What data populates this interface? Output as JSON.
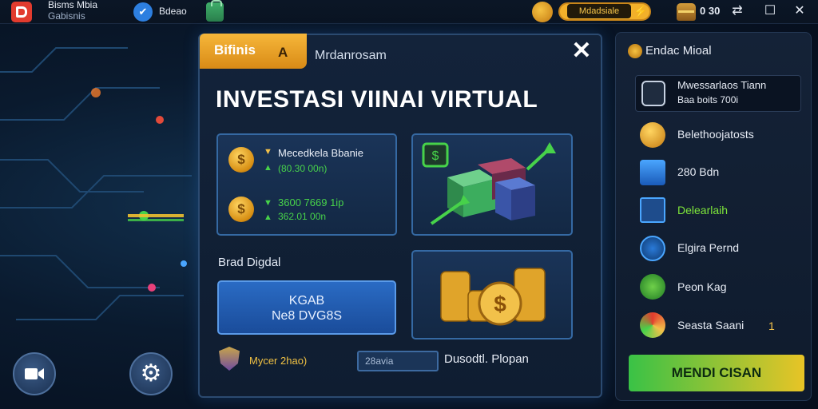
{
  "app": {
    "title": "Bisms Mbia",
    "subtitle": "Gabisnis",
    "badge_label": "Bdeao",
    "currency_pill": "Mdadsiale",
    "chest_count": "0 30"
  },
  "panel": {
    "tag_label": "Bifinis",
    "tag_icon": "A",
    "tab_label": "Mrdanrosam",
    "title": "INVESTASI VIINAI VIRTUAL",
    "rows": [
      {
        "label": "Mecedkela Bbanie",
        "sub": "(80.30 00n)"
      },
      {
        "label": "3600 7669 1ip",
        "sub": "362.01 00n"
      }
    ],
    "section_label": "Brad Digdal",
    "button_line1": "KGAB",
    "button_line2": "Ne8 DVG8S",
    "bottom_link": "Mycer 2hao)",
    "mini_input": "28avia",
    "bottom_right": "Dusodtl. Plopan"
  },
  "sidebar": {
    "header": "Endac Mioal",
    "card_title": "Mwessarlaos Tiann",
    "card_sub": "Baa boits 700i",
    "items": [
      {
        "label": "Belethoojatosts",
        "color": "#e7ecf5"
      },
      {
        "label": "280 Bdn",
        "color": "#e7ecf5"
      },
      {
        "label": "Delearlaih",
        "color": "#7ee63a"
      },
      {
        "label": "Elgira Pernd",
        "color": "#e7ecf5"
      },
      {
        "label": "Peon Kag",
        "color": "#e7ecf5"
      },
      {
        "label": "Seasta Saani",
        "color": "#e7ecf5"
      }
    ],
    "item_count": "1",
    "cta_label": "MENDI CISAN"
  },
  "colors": {
    "accent_orange": "#f2b02a",
    "panel_border": "#2b4a70",
    "cta_green": "#39c246",
    "highlight_green": "#7ee63a"
  },
  "icons": [
    "app-logo-icon",
    "check-badge-icon",
    "bag-icon",
    "face-icon",
    "bolt-icon",
    "chest-icon",
    "window-restore-icon",
    "window-maximize-icon",
    "close-icon",
    "coin-icon",
    "money-cubes-icon",
    "coin-stacks-icon",
    "shield-icon",
    "video-icon",
    "gear-icon"
  ]
}
